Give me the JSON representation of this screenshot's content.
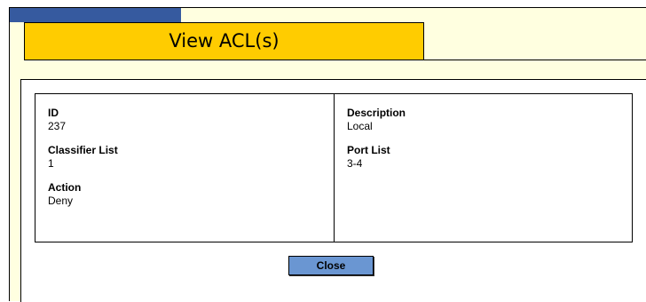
{
  "window": {
    "title": "View ACL(s)"
  },
  "acl": {
    "id_label": "ID",
    "id_value": "237",
    "classifier_label": "Classifier List",
    "classifier_value": "1",
    "action_label": "Action",
    "action_value": "Deny",
    "description_label": "Description",
    "description_value": "Local",
    "port_label": "Port List",
    "port_value": "3-4"
  },
  "buttons": {
    "close_label": "Close"
  },
  "colors": {
    "panel_bg": "#ffffe0",
    "title_bg": "#ffcc00",
    "topbar": "#365a9f",
    "button_bg": "#6a96d2"
  }
}
